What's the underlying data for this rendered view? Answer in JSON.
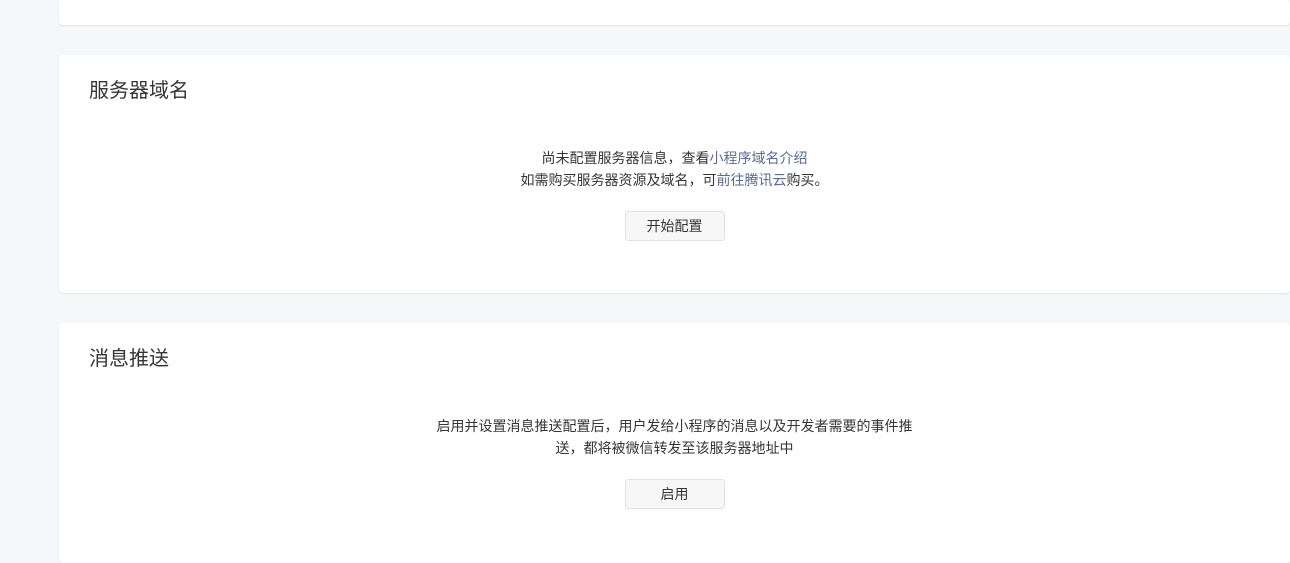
{
  "server_domain": {
    "title": "服务器域名",
    "line1_text": "尚未配置服务器信息，查看",
    "line1_link": "小程序域名介绍",
    "line2_text": "如需购买服务器资源及域名，可",
    "line2_link": "前往腾讯云",
    "line2_suffix": "购买。",
    "button_label": "开始配置"
  },
  "message_push": {
    "title": "消息推送",
    "line1": "启用并设置消息推送配置后，用户发给小程序的消息以及开发者需要的事件推",
    "line2": "送，都将被微信转发至该服务器地址中",
    "button_label": "启用"
  },
  "colors": {
    "link": "#576b95",
    "background": "#f6f7f9",
    "card": "#ffffff"
  }
}
